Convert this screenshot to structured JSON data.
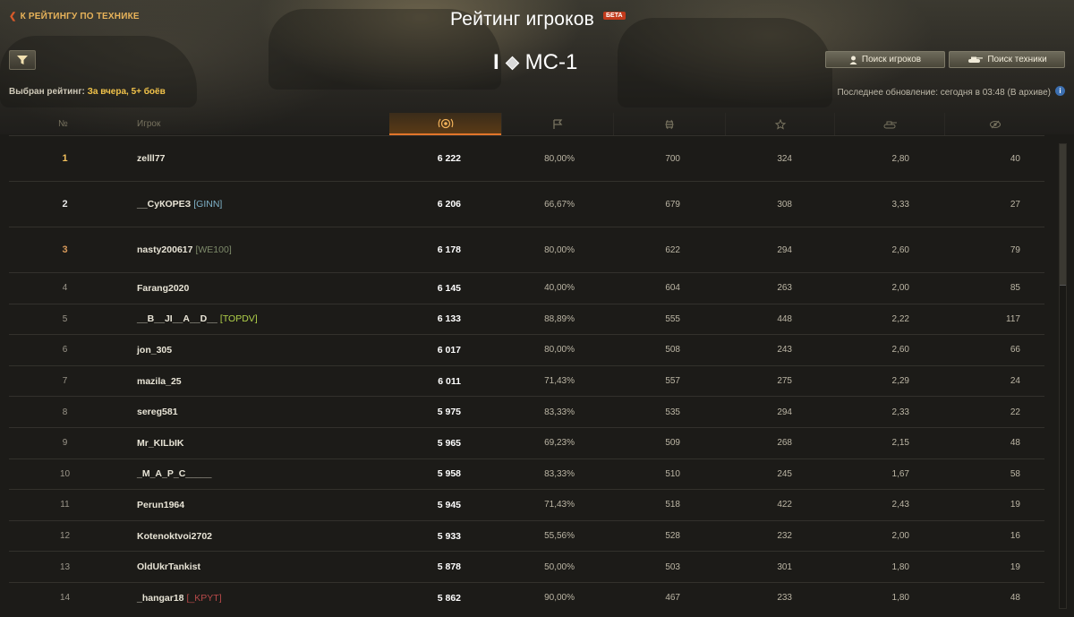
{
  "header": {
    "back_label": "К РЕЙТИНГУ ПО ТЕХНИКЕ",
    "title": "Рейтинг игроков",
    "beta_badge": "БЕТА",
    "vehicle_tier": "I",
    "vehicle_name": "МС-1",
    "search_players_label": "Поиск игроков",
    "search_vehicles_label": "Поиск техники",
    "rating_selected_label": "Выбран рейтинг:",
    "rating_selected_value": "За вчера, 5+ боёв",
    "last_update": "Последнее обновление: сегодня в 03:48 (В архиве)"
  },
  "table": {
    "columns": {
      "rank": "№",
      "player": "Игрок"
    },
    "rows": [
      {
        "rank": "1",
        "name": "zelll77",
        "clan": "",
        "clan_color": "",
        "rating": "6 222",
        "win": "80,00%",
        "dmg": "700",
        "xp": "324",
        "kill": "2,80",
        "spot": "40"
      },
      {
        "rank": "2",
        "name": "__СуКОРЕЗ",
        "clan": "[GINN]",
        "clan_color": "#7fb2c8",
        "rating": "6 206",
        "win": "66,67%",
        "dmg": "679",
        "xp": "308",
        "kill": "3,33",
        "spot": "27"
      },
      {
        "rank": "3",
        "name": "nasty200617",
        "clan": "[WE100]",
        "clan_color": "#7d8a6a",
        "rating": "6 178",
        "win": "80,00%",
        "dmg": "622",
        "xp": "294",
        "kill": "2,60",
        "spot": "79"
      },
      {
        "rank": "4",
        "name": "Farang2020",
        "clan": "",
        "clan_color": "",
        "rating": "6 145",
        "win": "40,00%",
        "dmg": "604",
        "xp": "263",
        "kill": "2,00",
        "spot": "85"
      },
      {
        "rank": "5",
        "name": "__B__JI__A__D__",
        "clan": "[TOPDV]",
        "clan_color": "#b2d24a",
        "rating": "6 133",
        "win": "88,89%",
        "dmg": "555",
        "xp": "448",
        "kill": "2,22",
        "spot": "117"
      },
      {
        "rank": "6",
        "name": "jon_305",
        "clan": "",
        "clan_color": "",
        "rating": "6 017",
        "win": "80,00%",
        "dmg": "508",
        "xp": "243",
        "kill": "2,60",
        "spot": "66"
      },
      {
        "rank": "7",
        "name": "mazila_25",
        "clan": "",
        "clan_color": "",
        "rating": "6 011",
        "win": "71,43%",
        "dmg": "557",
        "xp": "275",
        "kill": "2,29",
        "spot": "24"
      },
      {
        "rank": "8",
        "name": "sereg581",
        "clan": "",
        "clan_color": "",
        "rating": "5 975",
        "win": "83,33%",
        "dmg": "535",
        "xp": "294",
        "kill": "2,33",
        "spot": "22"
      },
      {
        "rank": "9",
        "name": "Mr_KILbIK",
        "clan": "",
        "clan_color": "",
        "rating": "5 965",
        "win": "69,23%",
        "dmg": "509",
        "xp": "268",
        "kill": "2,15",
        "spot": "48"
      },
      {
        "rank": "10",
        "name": "_M_A_P_C_____",
        "clan": "",
        "clan_color": "",
        "rating": "5 958",
        "win": "83,33%",
        "dmg": "510",
        "xp": "245",
        "kill": "1,67",
        "spot": "58"
      },
      {
        "rank": "11",
        "name": "Perun1964",
        "clan": "",
        "clan_color": "",
        "rating": "5 945",
        "win": "71,43%",
        "dmg": "518",
        "xp": "422",
        "kill": "2,43",
        "spot": "19"
      },
      {
        "rank": "12",
        "name": "Kotenoktvoi2702",
        "clan": "",
        "clan_color": "",
        "rating": "5 933",
        "win": "55,56%",
        "dmg": "528",
        "xp": "232",
        "kill": "2,00",
        "spot": "16"
      },
      {
        "rank": "13",
        "name": "OldUkrTankist",
        "clan": "",
        "clan_color": "",
        "rating": "5 878",
        "win": "50,00%",
        "dmg": "503",
        "xp": "301",
        "kill": "1,80",
        "spot": "19"
      },
      {
        "rank": "14",
        "name": "_hangar18",
        "clan": "[_KPYT]",
        "clan_color": "#b84a4a",
        "rating": "5 862",
        "win": "90,00%",
        "dmg": "467",
        "xp": "233",
        "kill": "1,80",
        "spot": "48"
      }
    ]
  },
  "colors": {
    "accent_orange": "#e2752a",
    "gold": "#f2c34a",
    "back_link": "#e8b35a"
  }
}
